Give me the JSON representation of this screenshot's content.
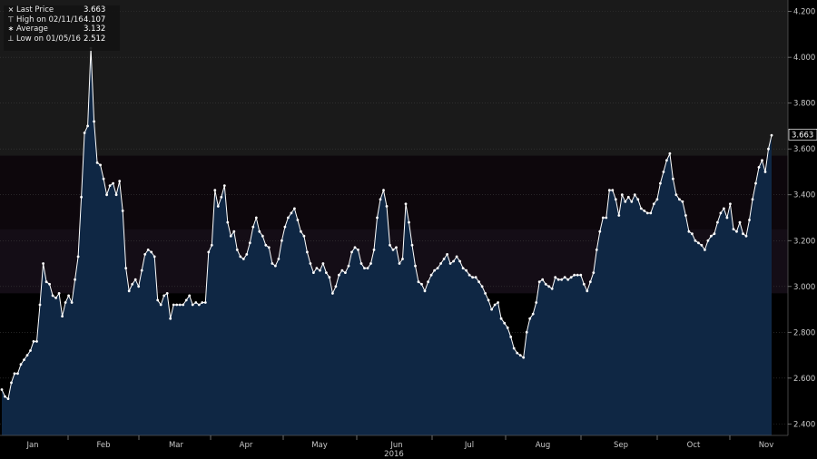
{
  "legend": [
    {
      "symbol": "×",
      "label": "Last Price",
      "value": "3.663"
    },
    {
      "symbol": "⊤",
      "label": "High on 02/11/16",
      "value": "4.107"
    },
    {
      "symbol": "∗",
      "label": "Average",
      "value": "3.132"
    },
    {
      "symbol": "⊥",
      "label": "Low on 01/05/16",
      "value": "2.512"
    }
  ],
  "last_price_tag": "3.663",
  "colors": {
    "background": "#000000",
    "band_dark": "#1a1a1a",
    "band_mid": "#0d070c",
    "band_lower": "#140d16",
    "area_fill": "#0f2744",
    "line": "#ffffff",
    "grid": "#3a3a3a",
    "axis_text": "#c8c8c8"
  },
  "chart_data": {
    "type": "area",
    "title": "",
    "xlabel": "2016",
    "ylabel": "",
    "ylim": [
      2.35,
      4.25
    ],
    "yticks": [
      "2.400",
      "2.600",
      "2.800",
      "3.000",
      "3.200",
      "3.400",
      "3.600",
      "3.800",
      "4.000",
      "4.200"
    ],
    "xticks": [
      "Jan",
      "Feb",
      "Mar",
      "Apr",
      "May",
      "Jun",
      "Jul",
      "Aug",
      "Sep",
      "Oct",
      "Nov"
    ],
    "year_label": "2016",
    "grid": true,
    "legend_position": "top-left",
    "series": [
      {
        "values": [
          2.55,
          2.52,
          2.51,
          2.58,
          2.62,
          2.62,
          2.66,
          2.68,
          2.7,
          2.72,
          2.76,
          2.76,
          2.92,
          3.1,
          3.02,
          3.01,
          2.96,
          2.95,
          2.97,
          2.87,
          2.93,
          2.96,
          2.93,
          3.03,
          3.13,
          3.39,
          3.67,
          3.7,
          4.04,
          3.72,
          3.54,
          3.53,
          3.47,
          3.4,
          3.44,
          3.45,
          3.4,
          3.46,
          3.33,
          3.08,
          2.98,
          3.01,
          3.03,
          3.0,
          3.07,
          3.14,
          3.16,
          3.15,
          3.13,
          2.94,
          2.92,
          2.96,
          2.97,
          2.86,
          2.92,
          2.92,
          2.92,
          2.92,
          2.94,
          2.96,
          2.92,
          2.93,
          2.92,
          2.93,
          2.93,
          3.15,
          3.18,
          3.42,
          3.35,
          3.39,
          3.44,
          3.28,
          3.22,
          3.24,
          3.16,
          3.13,
          3.12,
          3.14,
          3.19,
          3.26,
          3.3,
          3.24,
          3.22,
          3.18,
          3.17,
          3.1,
          3.09,
          3.12,
          3.2,
          3.26,
          3.3,
          3.32,
          3.34,
          3.29,
          3.24,
          3.22,
          3.15,
          3.1,
          3.06,
          3.08,
          3.07,
          3.1,
          3.06,
          3.04,
          2.97,
          3.0,
          3.05,
          3.07,
          3.06,
          3.09,
          3.15,
          3.17,
          3.16,
          3.1,
          3.08,
          3.08,
          3.1,
          3.16,
          3.3,
          3.38,
          3.42,
          3.35,
          3.18,
          3.16,
          3.17,
          3.1,
          3.12,
          3.36,
          3.28,
          3.18,
          3.09,
          3.02,
          3.01,
          2.98,
          3.02,
          3.05,
          3.07,
          3.08,
          3.1,
          3.12,
          3.14,
          3.1,
          3.11,
          3.13,
          3.11,
          3.08,
          3.07,
          3.05,
          3.04,
          3.04,
          3.02,
          3.0,
          2.97,
          2.94,
          2.9,
          2.92,
          2.93,
          2.86,
          2.84,
          2.82,
          2.78,
          2.73,
          2.71,
          2.7,
          2.69,
          2.8,
          2.86,
          2.88,
          2.93,
          3.02,
          3.03,
          3.01,
          3.0,
          2.99,
          3.04,
          3.03,
          3.03,
          3.04,
          3.03,
          3.04,
          3.05,
          3.05,
          3.05,
          3.01,
          2.98,
          3.02,
          3.06,
          3.16,
          3.24,
          3.3,
          3.3,
          3.42,
          3.42,
          3.38,
          3.31,
          3.4,
          3.37,
          3.39,
          3.37,
          3.4,
          3.38,
          3.34,
          3.33,
          3.32,
          3.32,
          3.36,
          3.38,
          3.45,
          3.5,
          3.55,
          3.58,
          3.47,
          3.4,
          3.38,
          3.37,
          3.31,
          3.24,
          3.23,
          3.2,
          3.19,
          3.18,
          3.16,
          3.2,
          3.22,
          3.23,
          3.28,
          3.32,
          3.34,
          3.3,
          3.36,
          3.25,
          3.24,
          3.28,
          3.23,
          3.22,
          3.29,
          3.38,
          3.45,
          3.52,
          3.55,
          3.5,
          3.6,
          3.66
        ]
      }
    ]
  }
}
